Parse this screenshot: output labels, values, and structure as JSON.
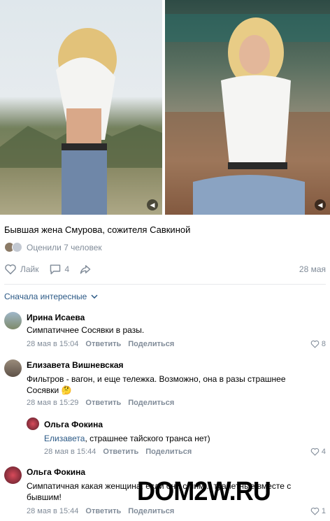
{
  "post": {
    "text": "Бывшая жена Смурова, сожителя Савкиной",
    "likes_text": "Оценили 7 человек",
    "like_label": "Лайк",
    "comments_count": "4",
    "date": "28 мая",
    "icons": [
      "video-icon",
      "heart-icon",
      "comment-icon",
      "share-icon"
    ]
  },
  "sort": {
    "label": "Сначала интересные"
  },
  "comments": [
    {
      "author": "Ирина Исаева",
      "text": "Симпатичнее Сосявки в разы.",
      "time": "28 мая в 15:04",
      "reply": "Ответить",
      "share": "Поделиться",
      "likes": "8"
    },
    {
      "author": "Елизавета Вишневская",
      "text": "Фильтров - вагон, и еще тележка. Возможно, она в разы страшнее Сосявки 🤔",
      "time": "28 мая в 15:29",
      "reply": "Ответить",
      "share": "Поделиться",
      "likes": ""
    },
    {
      "author": "Ольга Фокина",
      "mention": "Елизавета",
      "text": ", страшнее тайского транса нет)",
      "time": "28 мая в 15:44",
      "reply": "Ответить",
      "share": "Поделиться",
      "likes": "4"
    },
    {
      "author": "Ольга Фокина",
      "text": "Симпатичная какая женщина, если они с ним... туалетные вместе с бывшим!",
      "time": "28 мая в 15:44",
      "reply": "Ответить",
      "share": "Поделиться",
      "likes": "1"
    }
  ],
  "watermark": "DOM2W.RU"
}
